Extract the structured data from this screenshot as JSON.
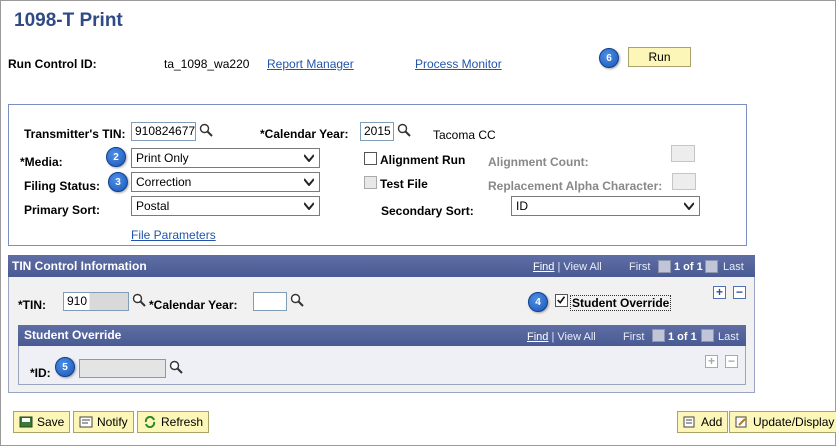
{
  "page": {
    "title": "1098-T Print"
  },
  "run_control": {
    "label": "Run Control ID:",
    "value": "ta_1098_wa220",
    "report_manager": "Report Manager",
    "process_monitor": "Process Monitor",
    "run_button": "Run",
    "badge": "6"
  },
  "form": {
    "transmitter_tin": {
      "label": "Transmitter's TIN:",
      "value": "910824677"
    },
    "calendar_year": {
      "label": "*Calendar Year:",
      "value": "2015",
      "description": "Tacoma CC"
    },
    "media": {
      "label": "*Media:",
      "value": "Print Only",
      "badge": "2"
    },
    "alignment_run": {
      "label": "Alignment Run",
      "checked": false
    },
    "alignment_count": {
      "label": "Alignment Count:"
    },
    "filing_status": {
      "label": "Filing Status:",
      "value": "Correction",
      "badge": "3"
    },
    "test_file": {
      "label": "Test File",
      "checked": false
    },
    "replacement_alpha": {
      "label": "Replacement Alpha Character:"
    },
    "primary_sort": {
      "label": "Primary Sort:",
      "value": "Postal"
    },
    "secondary_sort": {
      "label": "Secondary Sort:",
      "value": "ID"
    },
    "file_parameters": "File Parameters"
  },
  "tin_control": {
    "header": "TIN Control Information",
    "nav": {
      "find": "Find",
      "view_all": "View All",
      "first": "First",
      "count": "1 of 1",
      "last": "Last"
    },
    "tin": {
      "label": "*TIN:",
      "value": "910"
    },
    "calendar_year": {
      "label": "*Calendar Year:",
      "value": ""
    },
    "student_override": {
      "label": "Student Override",
      "checked": true,
      "badge": "4"
    },
    "plus": "+",
    "minus": "−"
  },
  "student_override": {
    "header": "Student Override",
    "nav": {
      "find": "Find",
      "view_all": "View All",
      "first": "First",
      "count": "1 of 1",
      "last": "Last"
    },
    "id": {
      "label": "*ID:",
      "value": "",
      "badge": "5"
    },
    "plus": "+",
    "minus": "−"
  },
  "footer": {
    "save": "Save",
    "notify": "Notify",
    "refresh": "Refresh",
    "add": "Add",
    "update_display": "Update/Display"
  },
  "colors": {
    "title": "#2f4a84",
    "header_bar": "#4a5a92",
    "button": "#fcf6b8",
    "badge": "#1a56b8",
    "link": "#2255aa"
  }
}
